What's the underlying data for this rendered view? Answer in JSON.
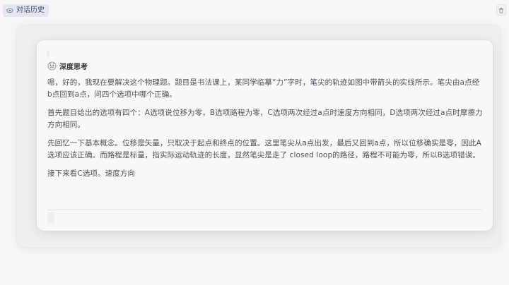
{
  "toolbar": {
    "history_tab_label": "对话历史",
    "history_icon": "eye-icon",
    "trash_icon": "trash-icon"
  },
  "thinking": {
    "title": "深度思考",
    "icon": "deep-think-icon",
    "paragraphs": [
      "嗯，好的，我现在要解决这个物理题。题目是书法课上，某同学临摹“力”字时，笔尖的轨迹如图中带箭头的实线所示。笔尖由a点经b点回到a点，问四个选项中哪个正确。",
      "首先题目给出的选项有四个：A选项说位移为零，B选项路程为零，C选项两次经过a点时速度方向相同，D选项两次经过a点时摩擦力方向相同。",
      "先回忆一下基本概念。位移是矢量，只取决于起点和终点的位置。这里笔尖从a点出发，最后又回到a点，所以位移确实是零，因此A选项应该正确。而路程是标量，指实际运动轨迹的长度，显然笔尖是走了 closed loop的路径，路程不可能为零，所以B选项错误。",
      "接下来看C选项。速度方向"
    ]
  },
  "colors": {
    "tab_bg": "#e3e7f1",
    "tab_text": "#3c4a66",
    "body_text": "#4f5259",
    "title_text": "#333438"
  }
}
